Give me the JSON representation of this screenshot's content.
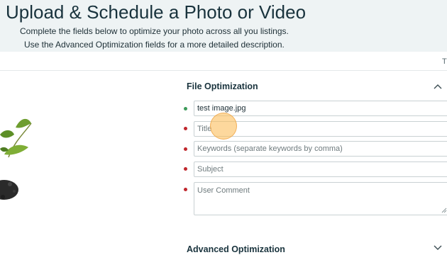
{
  "header": {
    "title": "Upload & Schedule a Photo or Video",
    "subtitle_line1": "Complete the fields below to optimize your photo across all you listings.",
    "subtitle_line2": "Use the Advanced Optimization fields for a more detailed description."
  },
  "topbar": {
    "right_char": "T"
  },
  "file_optimization": {
    "title": "File Optimization",
    "fields": [
      {
        "value": "test image.jpg",
        "placeholder": "",
        "status": "valid"
      },
      {
        "value": "",
        "placeholder": "Title",
        "status": "required"
      },
      {
        "value": "",
        "placeholder": "Keywords (separate keywords by comma)",
        "status": "required"
      },
      {
        "value": "",
        "placeholder": "Subject",
        "status": "required"
      },
      {
        "value": "",
        "placeholder": "User Comment",
        "status": "required"
      }
    ]
  },
  "advanced_optimization": {
    "title": "Advanced Optimization"
  },
  "icons": {
    "collapse": "chevron-up-icon",
    "expand": "chevron-down-icon",
    "preview": "plant-image"
  },
  "colors": {
    "header_bg": "#eef3f4",
    "valid_dot": "#3d9a5a",
    "required_dot": "#c0272d",
    "cursor_highlight": "#fbbe5c"
  }
}
